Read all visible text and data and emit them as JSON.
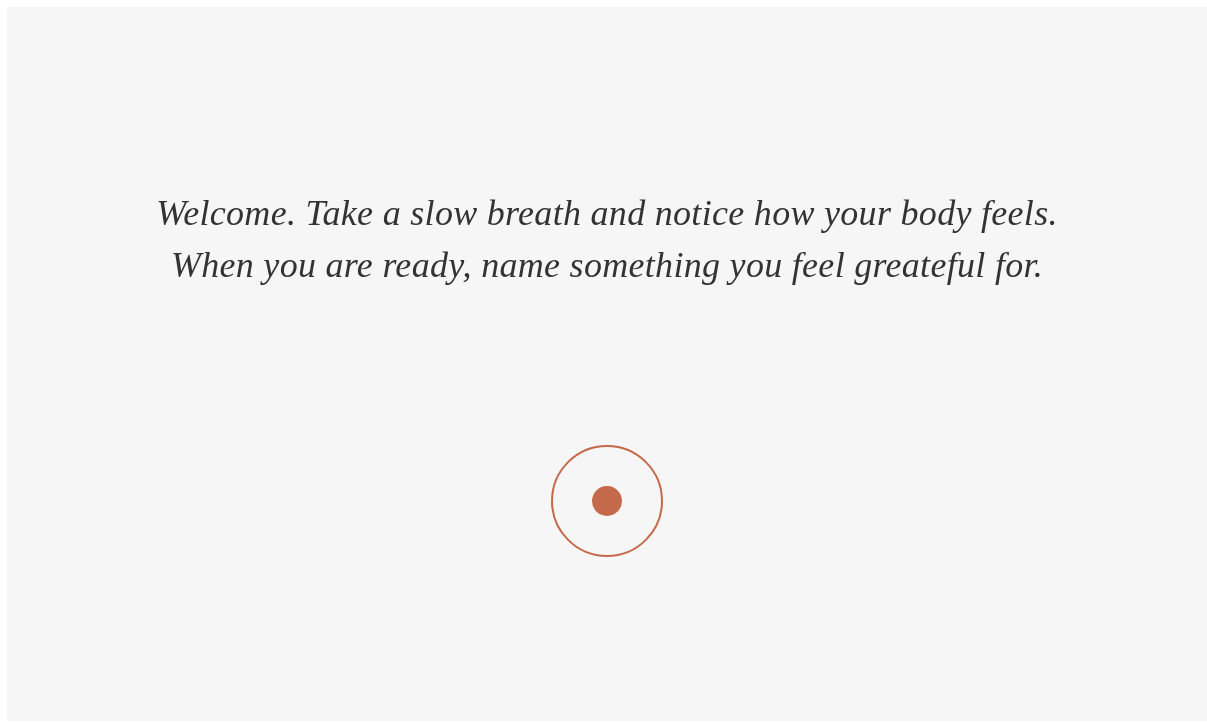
{
  "prompt": "Welcome. Take a slow breath and notice how your body feels. When you are ready, name something you feel greateful for."
}
